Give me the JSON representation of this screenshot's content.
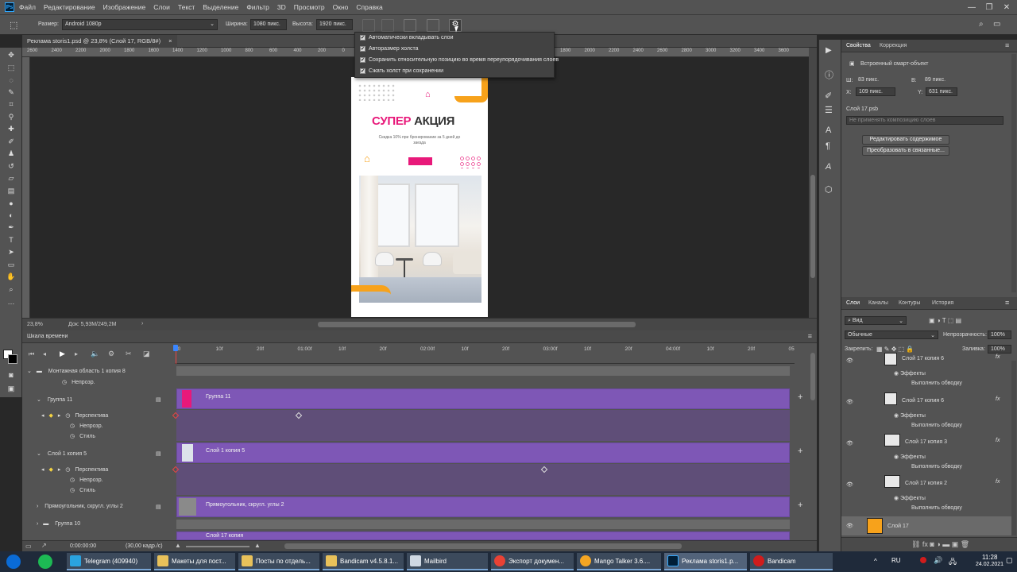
{
  "menubar": {
    "app_icon": "Ps",
    "items": [
      "Файл",
      "Редактирование",
      "Изображение",
      "Слои",
      "Текст",
      "Выделение",
      "Фильтр",
      "3D",
      "Просмотр",
      "Окно",
      "Справка"
    ]
  },
  "options": {
    "size_label": "Размер:",
    "size_value": "Android 1080p",
    "width_label": "Ширина:",
    "width_value": "1080 пикс.",
    "height_label": "Высота:",
    "height_value": "1920 пикс."
  },
  "doc_tab": {
    "title": "Реклама storis1.psd @ 23,8% (Слой 17, RGB/8#)",
    "close": "×"
  },
  "settings_popup": {
    "items": [
      "Автоматически вкладывать слои",
      "Авторазмер холста",
      "Сохранить относительную позицию во время переупорядочивания слоев",
      "Сжать холст при сохранении"
    ]
  },
  "ruler": {
    "ticks": [
      "2600",
      "2400",
      "2200",
      "2000",
      "1800",
      "1600",
      "1400",
      "1200",
      "1000",
      "800",
      "600",
      "400",
      "200",
      "0",
      "200",
      "400",
      "600",
      "800",
      "1000",
      "1200",
      "1400",
      "1600",
      "1800",
      "2000",
      "2200",
      "2400",
      "2600",
      "2800",
      "3000",
      "3200",
      "3400",
      "3600"
    ]
  },
  "artboard": {
    "title_pink": "СУПЕР",
    "title_dark": "АКЦИЯ",
    "subtitle": "Скидка 10% при бронировании за 5 дней до заезда"
  },
  "status": {
    "zoom": "23,8%",
    "doc": "Док: 5,93M/249,2M"
  },
  "timeline": {
    "title": "Шкала времени",
    "time_marks": [
      "00",
      "10f",
      "20f",
      "01:00f",
      "10f",
      "20f",
      "02:00f",
      "10f",
      "20f",
      "03:00f",
      "10f",
      "20f",
      "04:00f",
      "10f",
      "20f",
      "05:0"
    ],
    "rows": [
      {
        "label": "Монтажная область 1 копия 8",
        "kind": "group"
      },
      {
        "label": "Непрозр.",
        "kind": "prop"
      },
      {
        "label": "Группа 11",
        "kind": "layer"
      },
      {
        "label": "Перспектива",
        "kind": "prop"
      },
      {
        "label": "Непрозр.",
        "kind": "prop"
      },
      {
        "label": "Стиль",
        "kind": "prop"
      },
      {
        "label": "Слой 1 копия 5",
        "kind": "layer"
      },
      {
        "label": "Перспектива",
        "kind": "prop"
      },
      {
        "label": "Непрозр.",
        "kind": "prop"
      },
      {
        "label": "Стиль",
        "kind": "prop"
      },
      {
        "label": "Прямоугольник, скругл. углы 2",
        "kind": "layer"
      },
      {
        "label": "Группа 10",
        "kind": "layer"
      }
    ],
    "tracks": {
      "group11": "Группа 11",
      "sloy1k5": "Слой 1 копия 5",
      "rect2": "Прямоугольник, скругл. углы 2",
      "sloy17k": "Слой 17 копия"
    },
    "timecode": "0:00:00:00",
    "fps": "(30,00 кадр./с)"
  },
  "properties": {
    "tabs": [
      "Свойства",
      "Коррекция"
    ],
    "type": "Встроенный смарт-объект",
    "w_label": "Ш:",
    "w_value": "83 пикс.",
    "h_label": "В:",
    "h_value": "89 пикс.",
    "x_label": "X:",
    "x_value": "109 пикс.",
    "y_label": "Y:",
    "y_value": "631 пикс.",
    "file": "Слой 17.psb",
    "comp_placeholder": "Не применять композицию слоев",
    "btn_edit": "Редактировать содержимое",
    "btn_convert": "Преобразовать в связанные..."
  },
  "layers": {
    "tabs": [
      "Слои",
      "Каналы",
      "Контуры",
      "История"
    ],
    "filter": "Вид",
    "blend": "Обычные",
    "opacity_label": "Непрозрачность:",
    "opacity_value": "100%",
    "lock_label": "Закрепить:",
    "fill_label": "Заливка:",
    "fill_value": "100%",
    "items": [
      {
        "name": "Слой 17 копия 6",
        "effects": "Эффекты",
        "stroke": "Выполнить обводку"
      },
      {
        "name": "Слой 17 копия 6",
        "effects": "Эффекты",
        "stroke": "Выполнить обводку"
      },
      {
        "name": "Слой 17 копия 3",
        "effects": "Эффекты",
        "stroke": "Выполнить обводку"
      },
      {
        "name": "Слой 17 копия 2",
        "effects": "Эффекты",
        "stroke": "Выполнить обводку"
      },
      {
        "name": "Слой 17"
      }
    ]
  },
  "taskbar": {
    "apps": [
      {
        "label": "Telegram (409940)"
      },
      {
        "label": "Макеты для пост..."
      },
      {
        "label": "Посты по отдель..."
      },
      {
        "label": "Bandicam v4.5.8.1..."
      },
      {
        "label": "Mailbird"
      },
      {
        "label": "Экспорт докумен..."
      },
      {
        "label": "Mango Talker 3.6...."
      },
      {
        "label": "Реклама storis1.p..."
      },
      {
        "label": "Bandicam"
      }
    ],
    "lang": "RU",
    "time": "11:28",
    "date": "24.02.2021"
  },
  "colors": {
    "accent_pink": "#e8197a",
    "accent_orange": "#f7a21b",
    "track_purple": "#7e57b6",
    "panel_bg": "#535353"
  }
}
